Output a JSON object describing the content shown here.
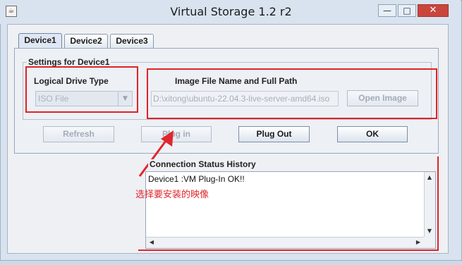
{
  "window": {
    "title": "Virtual Storage 1.2 r2",
    "minimize_glyph": "—",
    "maximize_glyph": "□",
    "close_glyph": "✕",
    "app_icon": "java-cup-icon"
  },
  "tabs": [
    {
      "label": "Device1",
      "active": true
    },
    {
      "label": "Device2",
      "active": false
    },
    {
      "label": "Device3",
      "active": false
    }
  ],
  "settings": {
    "group_title": "Settings for Device1",
    "drive_type_label": "Logical Drive Type",
    "drive_type_value": "ISO File",
    "image_label": "Image File Name and Full Path",
    "image_path": "D:\\xitong\\ubuntu-22.04.3-live-server-amd64.iso",
    "open_image_label": "Open Image"
  },
  "actions": {
    "refresh_label": "Refresh",
    "plug_in_label": "Plug in",
    "plug_out_label": "Plug Out",
    "ok_label": "OK"
  },
  "history": {
    "title": "Connection Status History",
    "lines": [
      "Device1 :VM Plug-In OK!!"
    ]
  },
  "annotation": {
    "text": "选择要安装的映像",
    "color": "#e0262d"
  }
}
